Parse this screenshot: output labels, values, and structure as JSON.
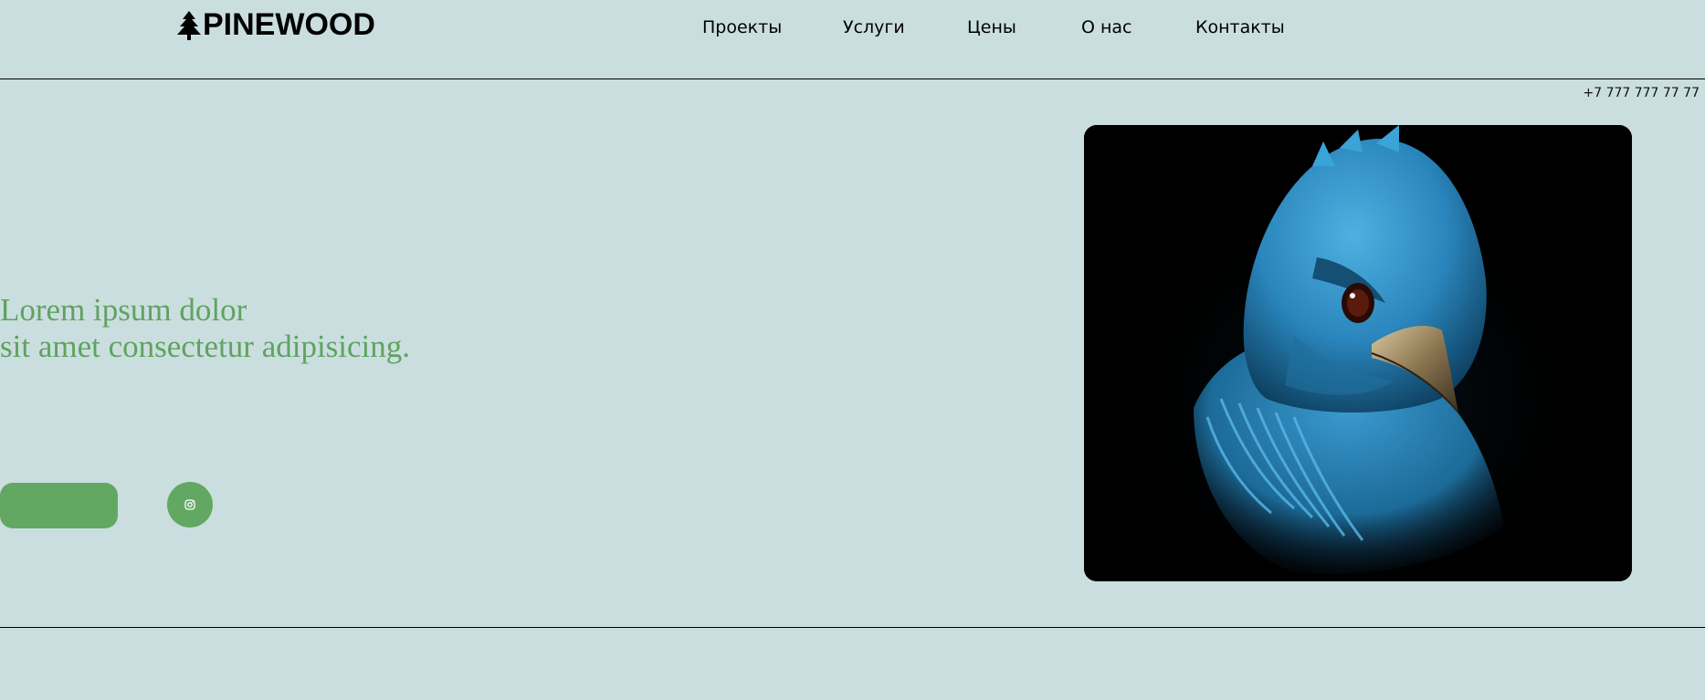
{
  "brand": {
    "name": "PINEWOOD",
    "icon": "pine-tree-icon"
  },
  "nav": {
    "items": [
      {
        "label": "Проекты"
      },
      {
        "label": "Услуги"
      },
      {
        "label": "Цены"
      },
      {
        "label": "О нас"
      },
      {
        "label": "Контакты"
      }
    ]
  },
  "contact": {
    "phone": "+7 777 777 77 77"
  },
  "hero": {
    "title_line1": "Lorem ipsum dolor",
    "title_line2": "sit amet consectetur adipisicing.",
    "cta_label": "",
    "social_icon": "instagram-icon",
    "image_subject": "blue-bird-illustration"
  },
  "colors": {
    "background": "#cbdedf",
    "accent": "#62a862",
    "title": "#5ea35f",
    "text": "#000000",
    "image_background": "#000000",
    "bird_blue": "#2f8fc4"
  }
}
